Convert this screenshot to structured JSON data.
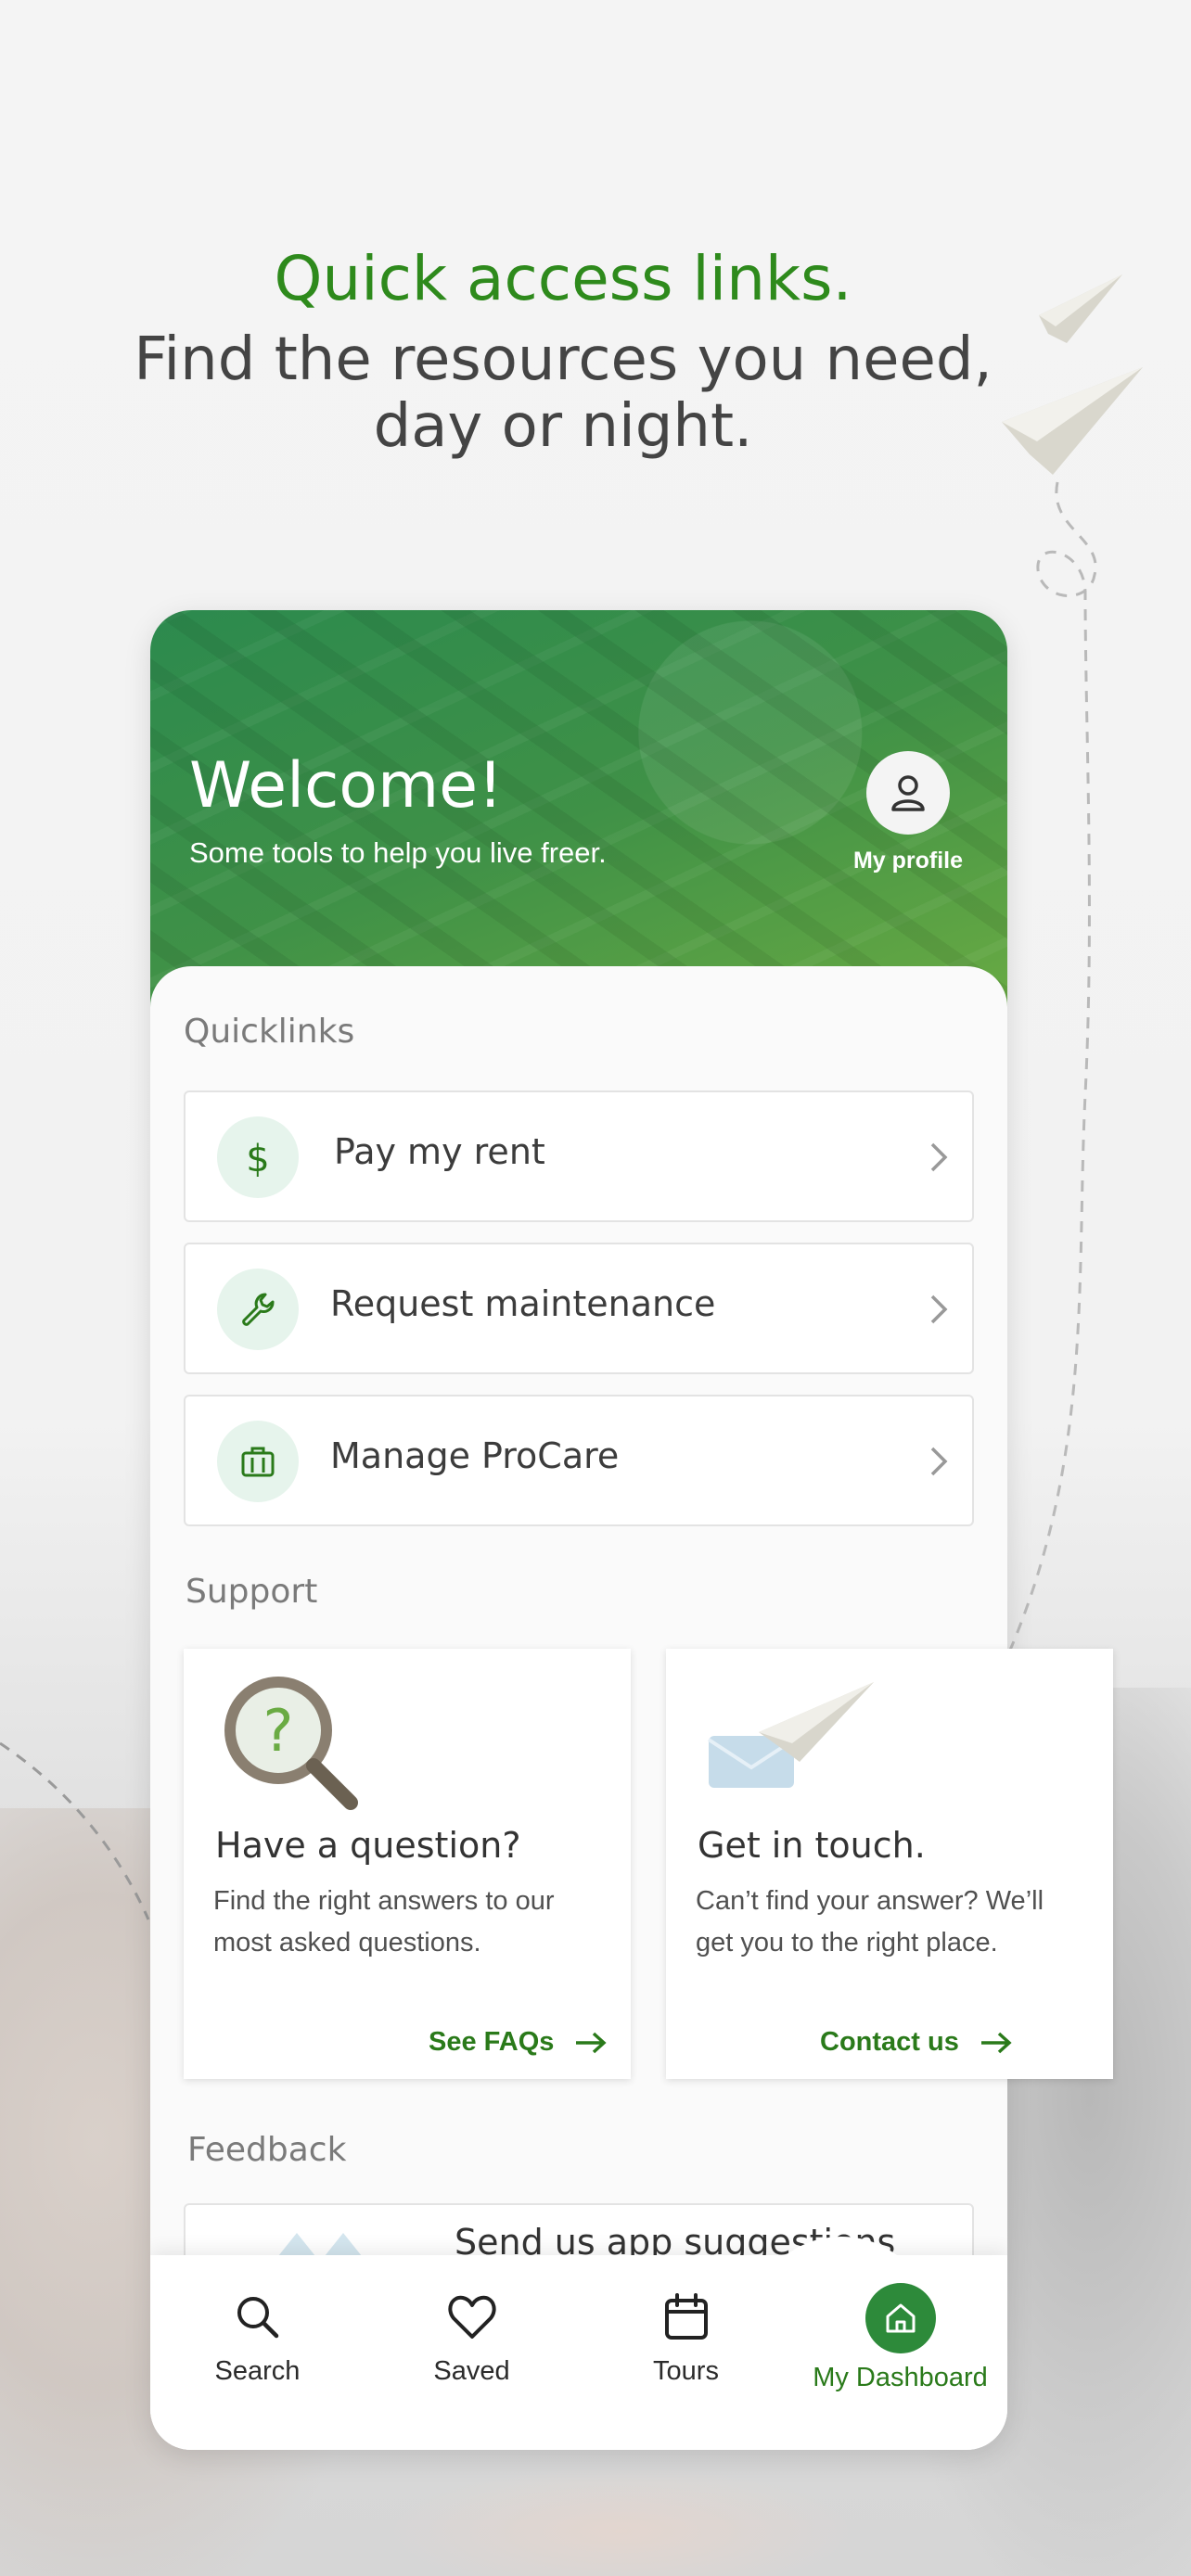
{
  "marketing": {
    "headline": "Quick access links.",
    "subline_1": "Find the resources you need,",
    "subline_2": "day or night."
  },
  "hero": {
    "title": "Welcome!",
    "subtitle": "Some tools to help you live freer.",
    "profile_label": "My profile"
  },
  "quicklinks": {
    "title": "Quicklinks",
    "items": [
      {
        "label": "Pay my rent",
        "icon": "dollar-icon"
      },
      {
        "label": "Request maintenance",
        "icon": "wrench-icon"
      },
      {
        "label": "Manage ProCare",
        "icon": "briefcase-icon"
      }
    ]
  },
  "support": {
    "title": "Support",
    "cards": [
      {
        "heading": "Have a question?",
        "body": "Find the right answers to our most asked questions.",
        "link": "See FAQs",
        "icon": "magnifier-question-icon"
      },
      {
        "heading": "Get in touch.",
        "body": "Can’t find your answer? We’ll get you to the right place.",
        "link": "Contact us",
        "icon": "paper-plane-envelope-icon"
      }
    ]
  },
  "feedback": {
    "title": "Feedback",
    "card_text": "Send us app suggestions"
  },
  "tabbar": {
    "items": [
      {
        "label": "Search",
        "icon": "search-icon"
      },
      {
        "label": "Saved",
        "icon": "heart-icon"
      },
      {
        "label": "Tours",
        "icon": "calendar-icon"
      },
      {
        "label": "My Dashboard",
        "icon": "home-icon",
        "active": true
      }
    ]
  },
  "colors": {
    "brand_green": "#2e8a1c",
    "link_green": "#2a7a1a",
    "hero_green": "#3f9147",
    "icon_bg": "#e6f4ec"
  }
}
